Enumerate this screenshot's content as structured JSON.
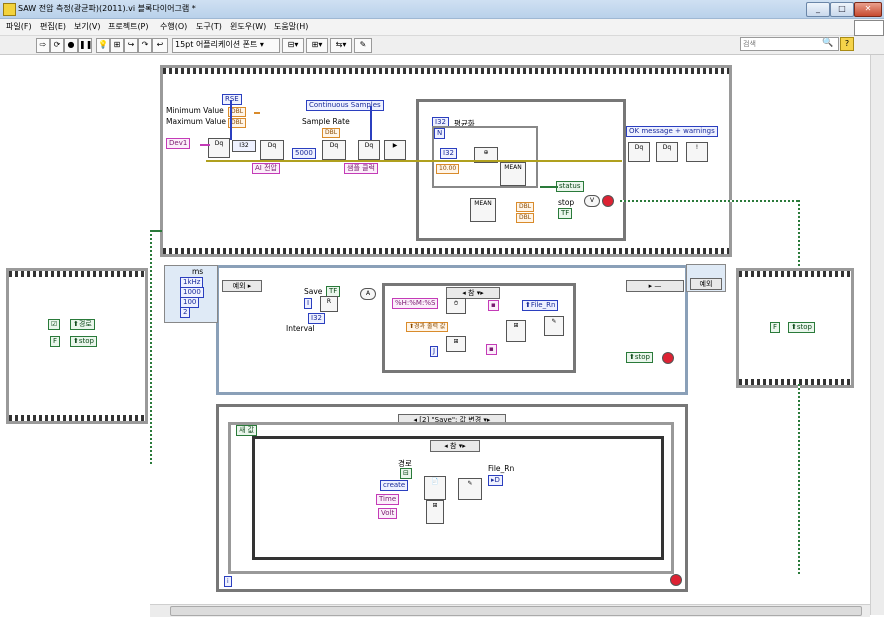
{
  "window": {
    "title": "SAW 전압 측정(광균파)(2011).vi 블록다이어그램 *",
    "minimize": "_",
    "maximize": "□",
    "close": "✕"
  },
  "menu": [
    "파일(F)",
    "편집(E)",
    "보기(V)",
    "프로젝트(P)",
    "수행(O)",
    "도구(T)",
    "윈도우(W)",
    "도움말(H)"
  ],
  "toolbar": {
    "font": "15pt 어플리케이션 폰트",
    "search_placeholder": "검색"
  },
  "daq": {
    "terminal_config": "RSE",
    "min_label": "Minimum Value",
    "max_label": "Maximum Value",
    "dbl": "DBL",
    "device": "Dev1",
    "ai_type": "AI 전압",
    "sample_rate_label": "Sample Rate",
    "samples": "5000",
    "continuous": "Continuous Samples",
    "sample_clock": "샘플 클럭",
    "average_label": "평균화",
    "i32": "I32",
    "n": "N",
    "avg_val": "10.00",
    "mean": "MEAN",
    "status": "status",
    "stop": "stop",
    "tf": "TF",
    "ok_message": "OK message + warnings",
    "daqmx": "DAQmx"
  },
  "timing": {
    "ms": "ms",
    "f": "1kHz",
    "dt": "1000",
    "t": "100",
    "n": "2"
  },
  "event": {
    "timeout_label": "예외",
    "save": "Save",
    "interval": "Interval",
    "a": "A",
    "true_case": "참",
    "format": "%H:%M:%S",
    "time_elapsed": "경과 출력 값",
    "file_rn": "File_Rn",
    "stop_local": "stop",
    "right_case": "예외"
  },
  "left_frame": {
    "path": "경로",
    "stop": "stop",
    "val_path": "경로"
  },
  "right_frame": {
    "stop": "stop"
  },
  "bottom": {
    "case_header": "[2] \"Save\": 값 변경",
    "new_val": "새 값",
    "true_case": "참",
    "path": "경로",
    "create": "create",
    "file_rn": "File_Rn",
    "time": "Time",
    "volt": "Volt"
  },
  "colors": {
    "orange": "#d98b2b",
    "blue": "#2b3fbf",
    "green": "#2a7a3a",
    "pink": "#c43bb7"
  }
}
